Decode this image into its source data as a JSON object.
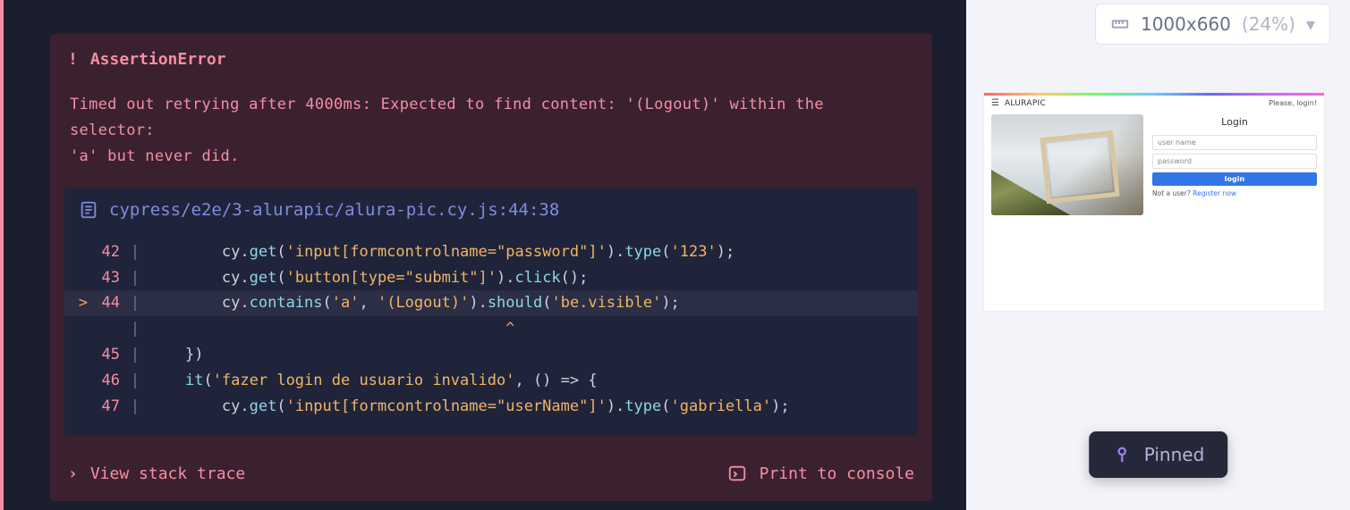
{
  "error": {
    "title": "AssertionError",
    "message_l1": "Timed out retrying after 4000ms: Expected to find content: '(Logout)' within the selector:",
    "message_l2": "'a' but never did."
  },
  "code": {
    "file_path": "cypress/e2e/3-alurapic/alura-pic.cy.js:44:38",
    "lines": {
      "l42": {
        "num": "42",
        "obj": "cy",
        "fn1": "get",
        "str1": "'input[formcontrolname=\"password\"]'",
        "fn2": "type",
        "str2": "'123'"
      },
      "l43": {
        "num": "43",
        "obj": "cy",
        "fn1": "get",
        "str1": "'button[type=\"submit\"]'",
        "fn2": "click"
      },
      "l44": {
        "num": "44",
        "marker": ">",
        "obj": "cy",
        "fn1": "contains",
        "str1a": "'a'",
        "str1b": "'(Logout)'",
        "fn2": "should",
        "str2": "'be.visible'"
      },
      "caret": "^",
      "l45": {
        "num": "45",
        "text": "})"
      },
      "l46": {
        "num": "46",
        "kw": "it",
        "str": "'fazer login de usuario invalido'",
        "arrow": "() => {"
      },
      "l47": {
        "num": "47",
        "obj": "cy",
        "fn1": "get",
        "str1": "'input[formcontrolname=\"userName\"]'",
        "fn2": "type",
        "str2": "'gabriella'"
      }
    }
  },
  "footer": {
    "view_stack": "View stack trace",
    "print_console": "Print to console"
  },
  "viewport": {
    "dims": "1000x660",
    "pct": "(24%)"
  },
  "preview": {
    "brand": "ALURAPIC",
    "please_login": "Please, login!",
    "heading": "Login",
    "user_placeholder": "user name",
    "pass_placeholder": "password",
    "login_btn": "login",
    "not_a_user": "Not a user?",
    "register": "Register now"
  },
  "pinned": {
    "label": "Pinned"
  }
}
